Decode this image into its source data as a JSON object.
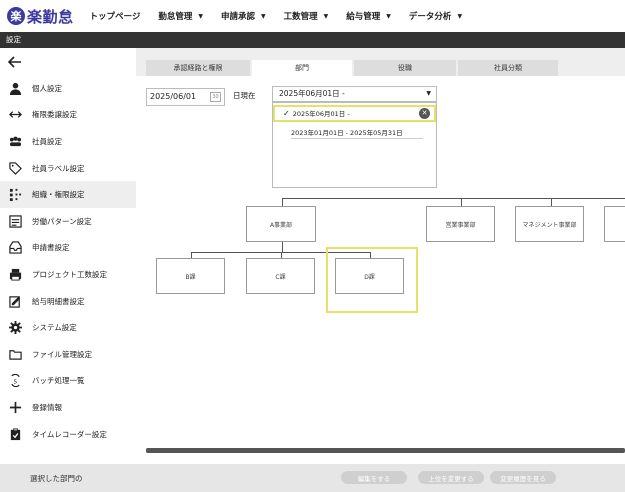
{
  "header": {
    "logo_mark": "楽",
    "logo_text": "楽勤怠",
    "nav": [
      {
        "label": "トップページ",
        "caret": false
      },
      {
        "label": "勤怠管理",
        "caret": true
      },
      {
        "label": "申請承認",
        "caret": true
      },
      {
        "label": "工数管理",
        "caret": true
      },
      {
        "label": "給与管理",
        "caret": true
      },
      {
        "label": "データ分析",
        "caret": true
      }
    ]
  },
  "subbar": {
    "title": "設定"
  },
  "sidebar": {
    "back_icon": "arrow-left-icon",
    "items": [
      {
        "label": "個人設定",
        "icon": "person-icon"
      },
      {
        "label": "権限委譲設定",
        "icon": "swap-arrows-icon"
      },
      {
        "label": "社員設定",
        "icon": "group-icon"
      },
      {
        "label": "社員ラベル設定",
        "icon": "tag-icon"
      },
      {
        "label": "組織・権限設定",
        "icon": "org-grid-icon",
        "active": true
      },
      {
        "label": "労働パターン設定",
        "icon": "list-icon"
      },
      {
        "label": "申請書設定",
        "icon": "inbox-icon"
      },
      {
        "label": "プロジェクト工数設定",
        "icon": "printer-icon"
      },
      {
        "label": "給与明細書設定",
        "icon": "edit-doc-icon"
      },
      {
        "label": "システム設定",
        "icon": "gear-icon"
      },
      {
        "label": "ファイル管理設定",
        "icon": "folder-icon"
      },
      {
        "label": "バッチ処理一覧",
        "icon": "batch-icon"
      },
      {
        "label": "登録情報",
        "icon": "plus-icon"
      },
      {
        "label": "タイムレコーダー設定",
        "icon": "clipboard-check-icon"
      }
    ]
  },
  "tabs": [
    {
      "label": "承認経路と権限",
      "active": false
    },
    {
      "label": "部門",
      "active": true
    },
    {
      "label": "役職",
      "active": false
    },
    {
      "label": "社員分類",
      "active": false
    }
  ],
  "filter": {
    "date_value": "2025/06/01",
    "calendar_icon_text": "30",
    "as_of_label": "日現在",
    "period_selected": "2025年06月01日 -",
    "options": [
      "2025年06月01日 -",
      "2023年01月01日 - 2025年05月31日"
    ]
  },
  "org_nodes": {
    "a_division": "A事業部",
    "sales_division": "営業事業部",
    "management_division": "マネジメント事業部",
    "b_section": "B課",
    "c_section": "C課",
    "d_section": "D課"
  },
  "bottombar": {
    "selected_label": "選択した部門の",
    "edit_button": "編集をする",
    "change_parent_button": "上位を変更する",
    "history_button": "変更履歴を見る"
  },
  "colors": {
    "brand": "#3a3aa0",
    "highlight": "#e3e36a",
    "subbar": "#333333"
  }
}
